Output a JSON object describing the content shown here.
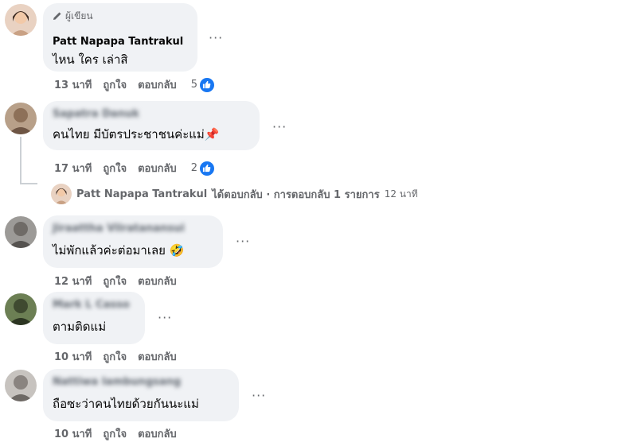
{
  "comments": [
    {
      "author_badge": "ผู้เขียน",
      "author": "Patt Napapa Tantrakul",
      "text": "ไหน ใคร เล่าสิ",
      "time": "13 นาที",
      "like_label": "ถูกใจ",
      "reply_label": "ตอบกลับ",
      "reaction_count": "5",
      "more": "···"
    },
    {
      "author": "Sapatra Danuk",
      "text": "คนไทย มีบัตรประชาชนค่ะแม่",
      "emoji": "📌",
      "time": "17 นาที",
      "like_label": "ถูกใจ",
      "reply_label": "ตอบกลับ",
      "reaction_count": "2",
      "more": "···"
    },
    {
      "author": "Jiraattha Vilratanansui",
      "text": "ไม่พักแล้วค่ะต่อมาเลย",
      "emoji": "🤣",
      "time": "12 นาที",
      "like_label": "ถูกใจ",
      "reply_label": "ตอบกลับ",
      "more": "···"
    },
    {
      "author": "Mark L Casso",
      "text": "ตามติดแม่",
      "time": "10 นาที",
      "like_label": "ถูกใจ",
      "reply_label": "ตอบกลับ",
      "more": "···"
    },
    {
      "author": "Nattiwa Iambungsang",
      "text": "ถือซะว่าคนไทยด้วยกันนะแม่",
      "time": "10 นาที",
      "like_label": "ถูกใจ",
      "reply_label": "ตอบกลับ",
      "more": "···"
    }
  ],
  "reply_summary": {
    "author": "Patt Napapa Tantrakul",
    "text": "ได้ตอบกลับ · การตอบกลับ 1 รายการ",
    "time": "12 นาที"
  },
  "colors": {
    "bubble": "#f0f2f5",
    "meta": "#65676b",
    "like_blue": "#1877f2"
  }
}
